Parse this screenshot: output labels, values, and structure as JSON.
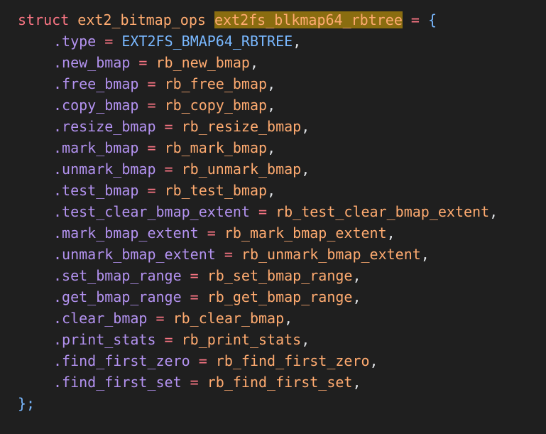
{
  "declaration": {
    "keyword": "struct",
    "type_name": "ext2_bitmap_ops",
    "var_name": "ext2fs_blkmap64_rbtree",
    "assign": "=",
    "open_brace": "{"
  },
  "fields": [
    {
      "name": ".type",
      "value": "EXT2FS_BMAP64_RBTREE"
    },
    {
      "name": ".new_bmap",
      "value": "rb_new_bmap"
    },
    {
      "name": ".free_bmap",
      "value": "rb_free_bmap"
    },
    {
      "name": ".copy_bmap",
      "value": "rb_copy_bmap"
    },
    {
      "name": ".resize_bmap",
      "value": "rb_resize_bmap"
    },
    {
      "name": ".mark_bmap",
      "value": "rb_mark_bmap"
    },
    {
      "name": ".unmark_bmap",
      "value": "rb_unmark_bmap"
    },
    {
      "name": ".test_bmap",
      "value": "rb_test_bmap"
    },
    {
      "name": ".test_clear_bmap_extent",
      "value": "rb_test_clear_bmap_extent"
    },
    {
      "name": ".mark_bmap_extent",
      "value": "rb_mark_bmap_extent"
    },
    {
      "name": ".unmark_bmap_extent",
      "value": "rb_unmark_bmap_extent"
    },
    {
      "name": ".set_bmap_range",
      "value": "rb_set_bmap_range"
    },
    {
      "name": ".get_bmap_range",
      "value": "rb_get_bmap_range"
    },
    {
      "name": ".clear_bmap",
      "value": "rb_clear_bmap"
    },
    {
      "name": ".print_stats",
      "value": "rb_print_stats"
    },
    {
      "name": ".find_first_zero",
      "value": "rb_find_first_zero"
    },
    {
      "name": ".find_first_set",
      "value": "rb_find_first_set"
    }
  ],
  "closing": "};",
  "colors": {
    "background": "#1f1f1f",
    "keyword": "#f97583",
    "identifier": "#ffab70",
    "field": "#b392f0",
    "constant": "#79b8ff",
    "selection_highlight": "#8a6d10"
  }
}
